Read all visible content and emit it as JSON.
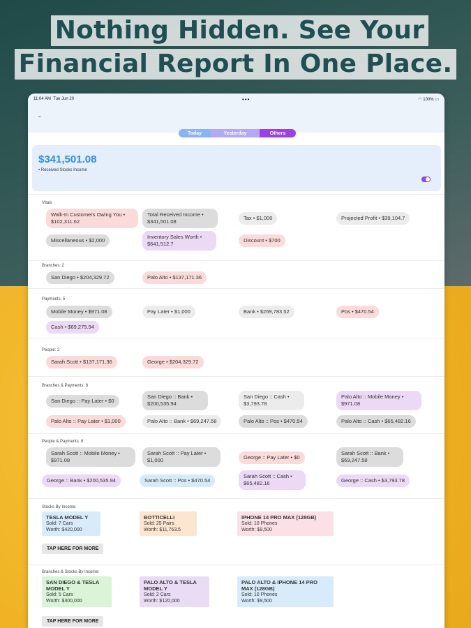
{
  "headline": {
    "line1": "Nothing Hidden. See Your",
    "line2": "Financial Report In One Place."
  },
  "statusbar": {
    "time": "11:04 AM",
    "date": "Tue Jun 20",
    "dots": "•••",
    "battery": "100%"
  },
  "tabs": [
    "Today",
    "Yesterday",
    "Others"
  ],
  "income": {
    "amount": "$341,501.08",
    "label": "• Received Stocks Income"
  },
  "vitals": {
    "title": "Vitals",
    "chips": [
      "Walk-In Customers Owing You • $102,311.62",
      "Total Received Income • $341,501.08",
      "Tax • $1,000",
      "Projected Profit • $39,104.7",
      "Miscellaneous • $2,000",
      "Inventory Sales Worth • $641,512.7",
      "Discount • $700"
    ]
  },
  "branches": {
    "title": "Branches: 2",
    "chips": [
      "San Diego • $204,329.72",
      "Palo Alto • $137,171.36"
    ]
  },
  "payments": {
    "title": "Payments: 5",
    "chips": [
      "Mobile Money • $971.08",
      "Pay Later • $1,000",
      "Bank • $269,783.52",
      "Pos • $470.54",
      "Cash • $69,275.94"
    ]
  },
  "people": {
    "title": "People: 2",
    "chips": [
      "Sarah Scott • $137,171.36",
      "George • $204,329.72"
    ]
  },
  "branches_payments": {
    "title": "Branches & Payments: 8",
    "chips": [
      "San Diego :: Pay Later • $0",
      "San Diego :: Bank • $200,535.94",
      "San Diego :: Cash • $3,793.78",
      "Palo Alto :: Mobile Money • $971.08",
      "Palo Alto :: Pay Later • $1,000",
      "Palo Alto :: Bank • $69,247.58",
      "Palo Alto :: Pos • $470.54",
      "Palo Alto :: Cash • $65,482.16"
    ]
  },
  "people_payments": {
    "title": "People & Payments: 8",
    "chips": [
      "Sarah Scott :: Mobile Money • $971.08",
      "Sarah Scott :: Pay Later • $1,000",
      "George :: Pay Later • $0",
      "Sarah Scott :: Bank • $69,247.58",
      "George :: Bank • $200,535.94",
      "Sarah Scott :: Pos • $470.54",
      "Sarah Scott :: Cash • $65,482.16",
      "George :: Cash • $3,793.78"
    ]
  },
  "stocks_income": {
    "title": "Stocks By Income:",
    "items": [
      {
        "name": "TESLA MODEL Y",
        "sold": "Sold: 7 Cars",
        "worth": "Worth: $420,000"
      },
      {
        "name": "BOTTICELLI",
        "sold": "Sold: 25 Pairs",
        "worth": "Worth: $11,763.5"
      },
      {
        "name": "IPHONE 14 PRO MAX (128GB)",
        "sold": "Sold: 10 Phones",
        "worth": "Worth: $9,500"
      }
    ],
    "button": "TAP HERE FOR MORE"
  },
  "branch_stocks": {
    "title": "Branches & Stocks By Income:",
    "items": [
      {
        "name": "SAN DIEGO & TESLA MODEL Y",
        "sold": "Sold: 5 Cars",
        "worth": "Worth: $300,000"
      },
      {
        "name": "PALO ALTO & TESLA MODEL Y",
        "sold": "Sold: 2 Cars",
        "worth": "Worth: $120,000"
      },
      {
        "name": "PALO ALTO & IPHONE 14 PRO MAX (128GB)",
        "sold": "Sold: 10 Phones",
        "worth": "Worth: $9,500"
      }
    ],
    "button": "TAP HERE FOR MORE"
  }
}
